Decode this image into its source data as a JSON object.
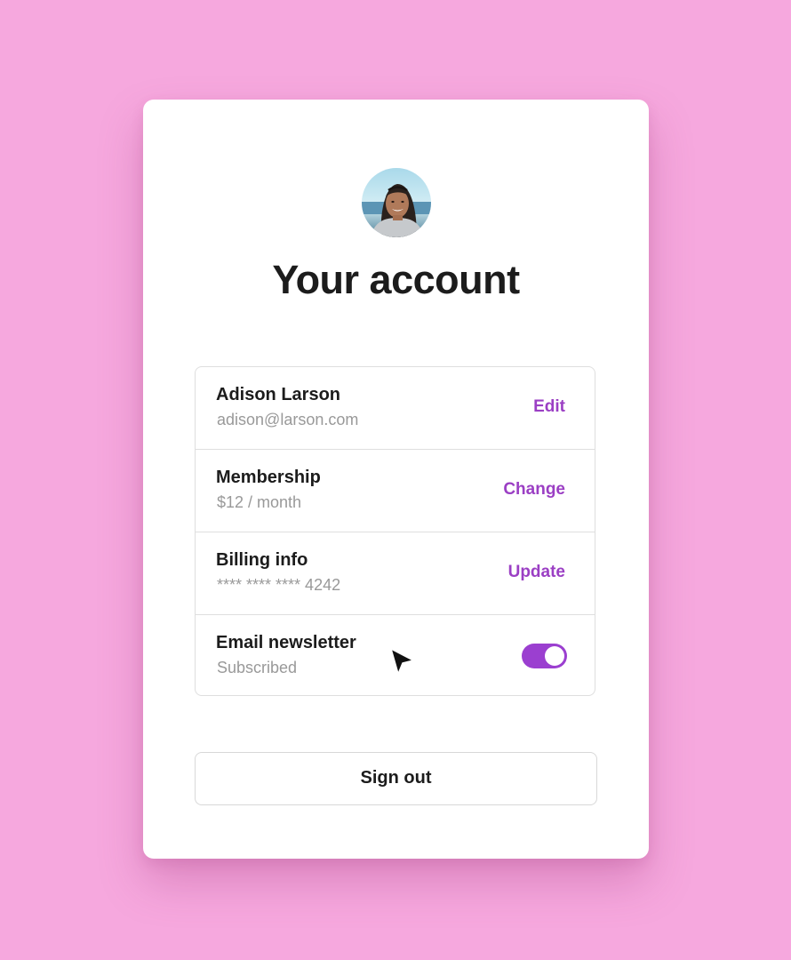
{
  "page": {
    "title": "Your account",
    "background_color": "#f6a8de",
    "accent_color": "#9b3fc4"
  },
  "avatar": {
    "icon": "profile-photo"
  },
  "rows": [
    {
      "title": "Adison Larson",
      "subtitle": "adison@larson.com",
      "action": "Edit"
    },
    {
      "title": "Membership",
      "subtitle": "$12 / month",
      "action": "Change"
    },
    {
      "title": "Billing info",
      "subtitle": "**** **** **** 4242",
      "action": "Update"
    },
    {
      "title": "Email newsletter",
      "subtitle": "Subscribed",
      "toggle_on": true
    }
  ],
  "signout": {
    "label": "Sign out"
  },
  "cursor": {
    "icon": "mouse-pointer-icon"
  }
}
